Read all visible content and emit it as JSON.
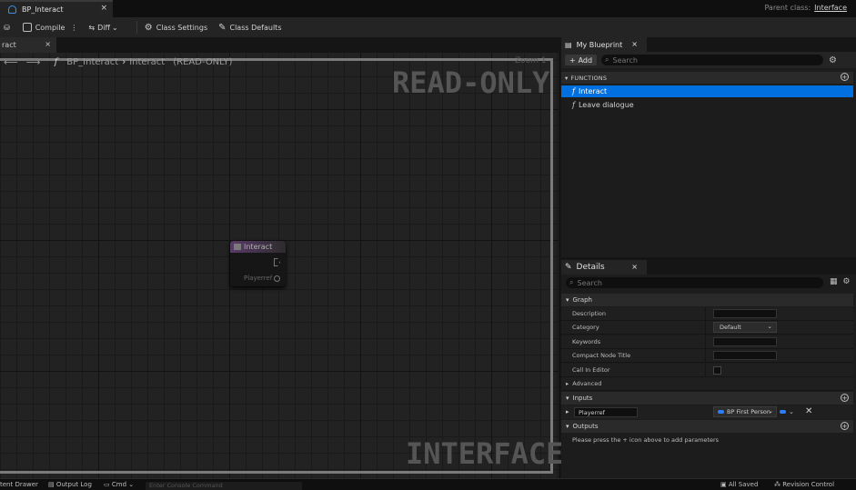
{
  "title_bar": {
    "document_tab": "BP_Interact",
    "parent_class_label": "Parent class:",
    "parent_class_value": "Interface"
  },
  "toolbar": {
    "compile": "Compile",
    "diff": "Diff",
    "class_settings": "Class Settings",
    "class_defaults": "Class Defaults"
  },
  "graph": {
    "tab_label": "ract",
    "breadcrumb_root": "BP_Interact",
    "breadcrumb_current": "Interact",
    "breadcrumb_mode": "(READ-ONLY)",
    "zoom_text": "Zoom 1",
    "watermark_readonly": "READ-ONLY",
    "watermark_interface": "INTERFACE",
    "node": {
      "title": "Interact",
      "pin_label": "Playerref"
    }
  },
  "my_blueprint": {
    "tab_label": "My Blueprint",
    "add_label": "Add",
    "search_placeholder": "Search",
    "functions_header": "FUNCTIONS",
    "functions": [
      "Interact",
      "Leave dialogue"
    ]
  },
  "details": {
    "tab_label": "Details",
    "search_placeholder": "Search",
    "graph_section": "Graph",
    "props": {
      "description": "Description",
      "category": "Category",
      "category_value": "Default",
      "keywords": "Keywords",
      "compact_node_title": "Compact Node Title",
      "call_in_editor": "Call In Editor",
      "advanced": "Advanced"
    },
    "inputs_section": "Inputs",
    "input": {
      "name": "Playerref",
      "type": "BP First Person"
    },
    "outputs_section": "Outputs",
    "outputs_hint": "Please press the + icon above to add parameters"
  },
  "status_bar": {
    "content_drawer": "tent Drawer",
    "output_log": "Output Log",
    "cmd": "Cmd",
    "console_placeholder": "Enter Console Command",
    "all_saved": "All Saved",
    "revision_control": "Revision Control"
  }
}
